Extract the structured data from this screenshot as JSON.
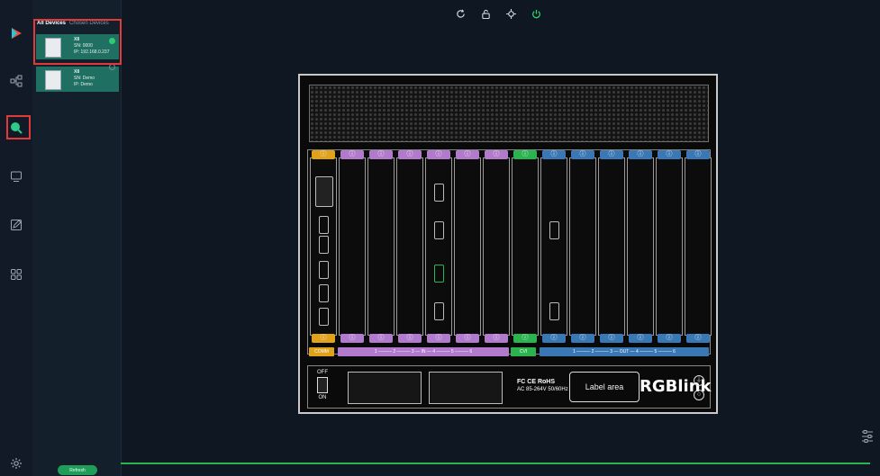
{
  "sidebar": {
    "items": [
      {
        "icon": "logo-play-icon"
      },
      {
        "icon": "network-topology-icon"
      },
      {
        "icon": "search-icon",
        "active": true
      },
      {
        "icon": "monitor-icon"
      },
      {
        "icon": "edit-icon"
      },
      {
        "icon": "grid-apps-icon"
      },
      {
        "icon": "settings-gear-icon"
      }
    ]
  },
  "device_panel": {
    "tabs": [
      "All Devices",
      "Chosen Devices"
    ],
    "devices": [
      {
        "name": "X8",
        "sn": "SN: 0000",
        "ip": "IP: 192.168.0.237",
        "selected": true
      },
      {
        "name": "X8",
        "sn": "SN: Demo",
        "ip": "IP: Demo",
        "selected": false
      }
    ],
    "refresh_label": "Refresh"
  },
  "toolbar": {
    "buttons": [
      "refresh-icon",
      "lock-icon",
      "target-icon",
      "power-icon"
    ]
  },
  "chassis": {
    "top_tabs": [
      "COMM",
      "IN",
      "IN",
      "IN",
      "IN",
      "IN",
      "IN",
      "CV",
      "OUT",
      "OUT",
      "OUT",
      "OUT",
      "OUT",
      "OUT"
    ],
    "label_comm": "COMM",
    "label_in": "1 ——— 2 ——— 3 — IN — 4 ——— 5 ——— 6",
    "label_cv": "CVI",
    "label_out": "1 ——— 2 ——— 3 — OUT — 4 ——— 5 ——— 6",
    "switch_off": "OFF",
    "switch_on": "ON",
    "cert_line1": "FC CE RoHS",
    "cert_line2": "AC 85-264V 50/60Hz",
    "label_area": "Label area",
    "brand": "RGBlink",
    "colors": {
      "comm": "#e0a11b",
      "in": "#b27acc",
      "cv": "#2bb34f",
      "out": "#3a78b5"
    }
  }
}
